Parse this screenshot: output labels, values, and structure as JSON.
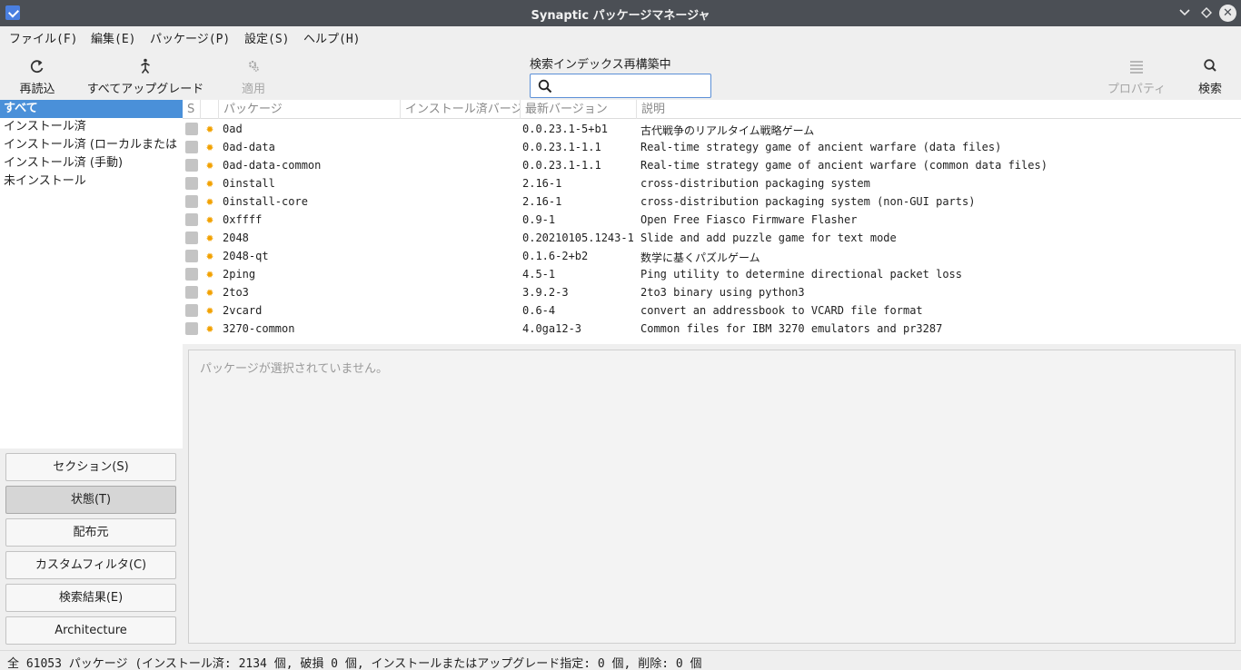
{
  "window": {
    "title": "Synaptic パッケージマネージャ"
  },
  "menubar": {
    "items": [
      "ファイル(F)",
      "編集(E)",
      "パッケージ(P)",
      "設定(S)",
      "ヘルプ(H)"
    ]
  },
  "toolbar": {
    "reload_label": "再読込",
    "upgrade_all_label": "すべてアップグレード",
    "apply_label": "適用",
    "properties_label": "プロパティ",
    "search_label": "検索"
  },
  "search": {
    "status_label": "検索インデックス再構築中",
    "value": ""
  },
  "sidebar": {
    "filters": [
      {
        "label": "すべて",
        "selected": true
      },
      {
        "label": "インストール済",
        "selected": false
      },
      {
        "label": "インストール済 (ローカルまたは",
        "selected": false
      },
      {
        "label": "インストール済 (手動)",
        "selected": false
      },
      {
        "label": "未インストール",
        "selected": false
      }
    ],
    "buttons": [
      {
        "label": "セクション(S)",
        "active": false
      },
      {
        "label": "状態(T)",
        "active": true
      },
      {
        "label": "配布元",
        "active": false
      },
      {
        "label": "カスタムフィルタ(C)",
        "active": false
      },
      {
        "label": "検索結果(E)",
        "active": false
      },
      {
        "label": "Architecture",
        "active": false
      }
    ]
  },
  "package_table": {
    "columns": {
      "status": "S",
      "package": "パッケージ",
      "installed_version": "インストール済バージョン",
      "latest_version": "最新バージョン",
      "description": "説明"
    },
    "rows": [
      {
        "name": "0ad",
        "latest": "0.0.23.1-5+b1",
        "desc": "古代戦争のリアルタイム戦略ゲーム"
      },
      {
        "name": "0ad-data",
        "latest": "0.0.23.1-1.1",
        "desc": "Real-time strategy game of ancient warfare (data files)"
      },
      {
        "name": "0ad-data-common",
        "latest": "0.0.23.1-1.1",
        "desc": "Real-time strategy game of ancient warfare (common data files)"
      },
      {
        "name": "0install",
        "latest": "2.16-1",
        "desc": "cross-distribution packaging system"
      },
      {
        "name": "0install-core",
        "latest": "2.16-1",
        "desc": "cross-distribution packaging system (non-GUI parts)"
      },
      {
        "name": "0xffff",
        "latest": "0.9-1",
        "desc": "Open Free Fiasco Firmware Flasher"
      },
      {
        "name": "2048",
        "latest": "0.20210105.1243-1",
        "desc": "Slide and add puzzle game for text mode"
      },
      {
        "name": "2048-qt",
        "latest": "0.1.6-2+b2",
        "desc": "数学に基くパズルゲーム"
      },
      {
        "name": "2ping",
        "latest": "4.5-1",
        "desc": "Ping utility to determine directional packet loss"
      },
      {
        "name": "2to3",
        "latest": "3.9.2-3",
        "desc": "2to3 binary using python3"
      },
      {
        "name": "2vcard",
        "latest": "0.6-4",
        "desc": "convert an addressbook to VCARD file format"
      },
      {
        "name": "3270-common",
        "latest": "4.0ga12-3",
        "desc": "Common files for IBM 3270 emulators and pr3287"
      }
    ]
  },
  "detail": {
    "empty_text": "パッケージが選択されていません。"
  },
  "statusbar": {
    "text": "全 61053 パッケージ (インストール済: 2134 個, 破損 0 個, インストールまたはアップグレード指定: 0 個, 削除: 0 個"
  }
}
